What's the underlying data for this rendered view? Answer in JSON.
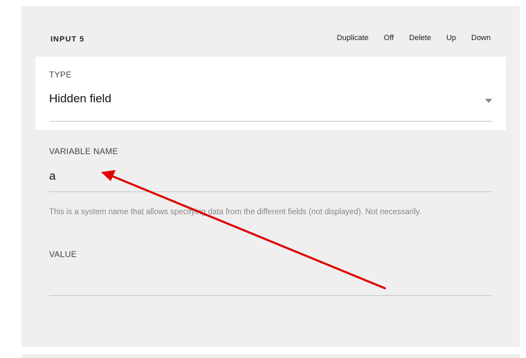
{
  "section": {
    "title": "INPUT 5",
    "actions": {
      "duplicate": "Duplicate",
      "off": "Off",
      "delete": "Delete",
      "up": "Up",
      "down": "Down"
    }
  },
  "type_field": {
    "label": "TYPE",
    "value": "Hidden field",
    "icon": "chevron-down-icon"
  },
  "variable_field": {
    "label": "VARIABLE NAME",
    "value": "a",
    "hint": "This is a system name that allows specifying data from the different fields (not displayed). Not necessarily."
  },
  "value_field": {
    "label": "VALUE",
    "value": ""
  },
  "annotation": {
    "color": "#e00000",
    "icon": "arrow-annotation"
  }
}
